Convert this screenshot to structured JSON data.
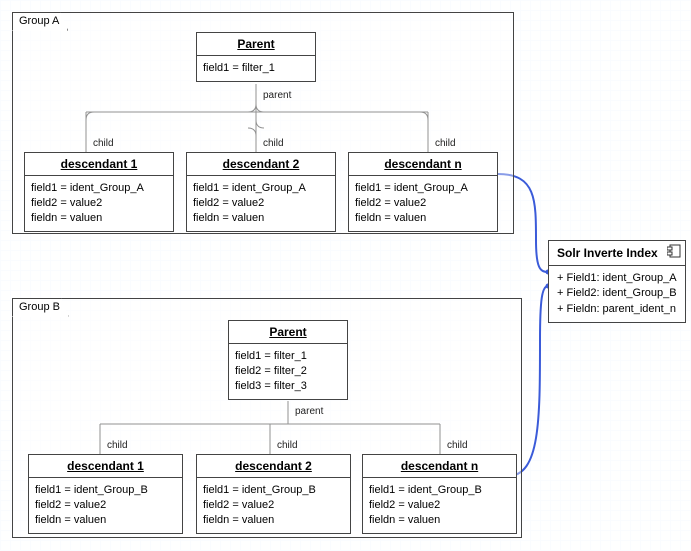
{
  "groupA": {
    "title": "Group A",
    "parent": {
      "title": "Parent",
      "fields": "field1 = filter_1",
      "edgeLabel": "parent"
    },
    "childEdgeLabel": "child",
    "descendants": [
      {
        "title": "descendant 1",
        "fields": "field1 = ident_Group_A\nfield2 = value2\nfieldn = valuen"
      },
      {
        "title": "descendant 2",
        "fields": "field1 = ident_Group_A\nfield2 = value2\nfieldn = valuen"
      },
      {
        "title": "descendant n",
        "fields": "field1 = ident_Group_A\nfield2 = value2\nfieldn = valuen"
      }
    ]
  },
  "groupB": {
    "title": "Group B",
    "parent": {
      "title": "Parent",
      "fields": "field1 = filter_1\nfield2 = filter_2\nfield3 = filter_3",
      "edgeLabel": "parent"
    },
    "childEdgeLabel": "child",
    "descendants": [
      {
        "title": "descendant 1",
        "fields": "field1 = ident_Group_B\nfield2 = value2\nfieldn = valuen"
      },
      {
        "title": "descendant 2",
        "fields": "field1 = ident_Group_B\nfield2 = value2\nfieldn = valuen"
      },
      {
        "title": "descendant n",
        "fields": "field1 = ident_Group_B\nfield2 = value2\nfieldn = valuen"
      }
    ]
  },
  "solr": {
    "title": "Solr Inverte Index",
    "entries": "+ Field1: ident_Group_A\n+ Field2: ident_Group_B\n+ Fieldn: parent_ident_n"
  },
  "chart_data": {
    "type": "table",
    "title": "Solr parent-child index grouping diagram",
    "groups": [
      {
        "name": "Group A",
        "parent": {
          "field1": "filter_1"
        },
        "children": [
          {
            "name": "descendant 1",
            "field1": "ident_Group_A",
            "field2": "value2",
            "fieldn": "valuen"
          },
          {
            "name": "descendant 2",
            "field1": "ident_Group_A",
            "field2": "value2",
            "fieldn": "valuen"
          },
          {
            "name": "descendant n",
            "field1": "ident_Group_A",
            "field2": "value2",
            "fieldn": "valuen"
          }
        ]
      },
      {
        "name": "Group B",
        "parent": {
          "field1": "filter_1",
          "field2": "filter_2",
          "field3": "filter_3"
        },
        "children": [
          {
            "name": "descendant 1",
            "field1": "ident_Group_B",
            "field2": "value2",
            "fieldn": "valuen"
          },
          {
            "name": "descendant 2",
            "field1": "ident_Group_B",
            "field2": "value2",
            "fieldn": "valuen"
          },
          {
            "name": "descendant n",
            "field1": "ident_Group_B",
            "field2": "value2",
            "fieldn": "valuen"
          }
        ]
      }
    ],
    "inverted_index": {
      "Field1": "ident_Group_A",
      "Field2": "ident_Group_B",
      "Fieldn": "parent_ident_n"
    }
  }
}
